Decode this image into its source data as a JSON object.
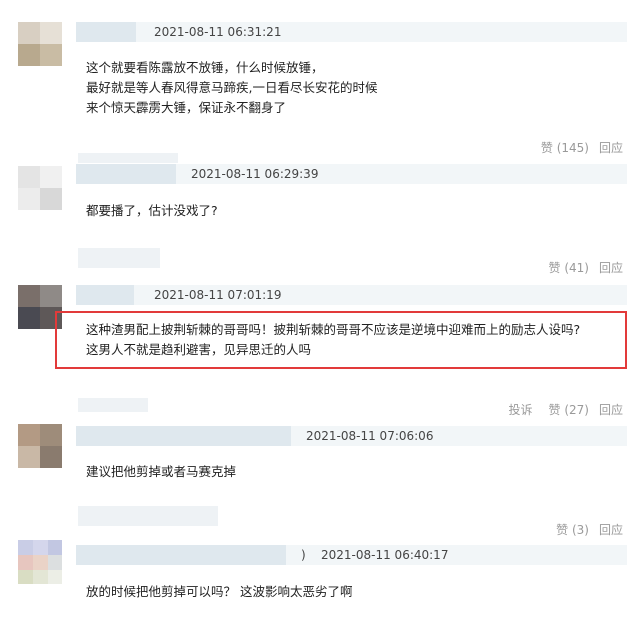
{
  "comments": [
    {
      "time": "2021-08-11 06:31:21",
      "lines": [
        "这个就要看陈露放不放锤，什么时候放锤，",
        "最好就是等人春风得意马蹄疾,一日看尽长安花的时候",
        "来个惊天霹雳大锤，保证永不翻身了"
      ],
      "like_label": "赞 (145)",
      "reply_label": "回应"
    },
    {
      "time": "2021-08-11 06:29:39",
      "lines": [
        "都要播了，估计没戏了?"
      ],
      "like_label": "赞 (41)",
      "reply_label": "回应"
    },
    {
      "time": "2021-08-11 07:01:19",
      "lines": [
        "这种渣男配上披荆斩棘的哥哥吗！披荆斩棘的哥哥不应该是逆境中迎难而上的励志人设吗?",
        "这男人不就是趋利避害，见异思迁的人吗"
      ],
      "report_label": "投诉",
      "like_label": "赞 (27)",
      "reply_label": "回应"
    },
    {
      "time": "2021-08-11 07:06:06",
      "lines": [
        "建议把他剪掉或者马赛克掉"
      ],
      "like_label": "赞 (3)",
      "reply_label": "回应"
    },
    {
      "time_prefix": ")",
      "time": "2021-08-11 06:40:17",
      "lines": [
        "放的时候把他剪掉可以吗？ 这波影响太恶劣了啊"
      ]
    }
  ],
  "colors": {
    "highlight_border": "#e23a3a",
    "meta_bar": "#f2f6f8",
    "action_text": "#9a9a9a"
  }
}
